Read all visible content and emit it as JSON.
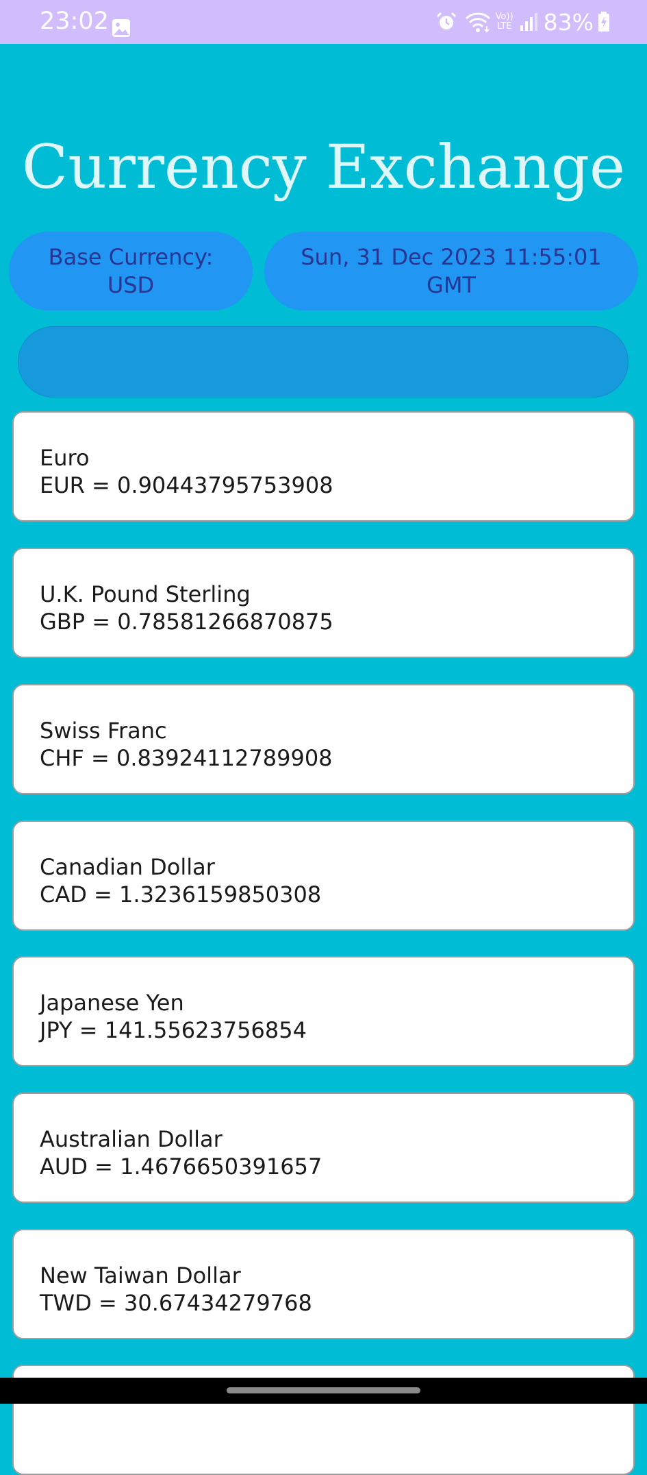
{
  "status_bar": {
    "time": "23:02",
    "battery_percent": "83%",
    "icons": [
      "gallery-icon",
      "alarm-icon",
      "wifi-icon",
      "volte-icon",
      "signal-icon",
      "battery-charging-icon"
    ],
    "volte_top": "Vo))",
    "volte_bottom": "LTE"
  },
  "header": {
    "title": "Currency Exchange"
  },
  "info": {
    "base_currency_line1": "Base Currency:",
    "base_currency_line2": "USD",
    "timestamp_line1": "Sun, 31 Dec 2023 11:55:01",
    "timestamp_line2": "GMT"
  },
  "search": {
    "placeholder": ""
  },
  "currencies": [
    {
      "name": "Euro",
      "rate": "EUR = 0.90443795753908"
    },
    {
      "name": "U.K. Pound Sterling",
      "rate": "GBP = 0.78581266870875"
    },
    {
      "name": "Swiss Franc",
      "rate": "CHF = 0.83924112789908"
    },
    {
      "name": "Canadian Dollar",
      "rate": "CAD = 1.3236159850308"
    },
    {
      "name": "Japanese Yen",
      "rate": "JPY = 141.55623756854"
    },
    {
      "name": "Australian Dollar",
      "rate": "AUD = 1.4676650391657"
    },
    {
      "name": "New Taiwan Dollar",
      "rate": "TWD = 30.67434279768"
    }
  ],
  "colors": {
    "background": "#00BCD4",
    "status_bar": "#D1BDFC",
    "pill": "#2196F3",
    "pill_text": "#283593",
    "title": "#E0F7FA",
    "card": "#FFFFFF"
  }
}
